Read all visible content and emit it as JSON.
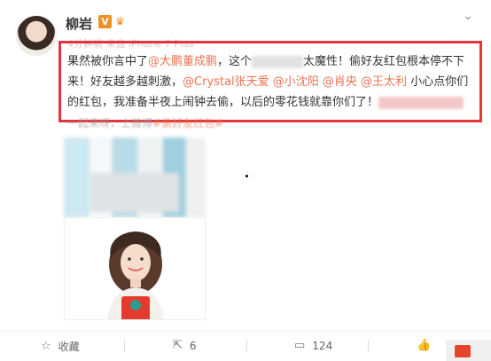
{
  "post": {
    "username": "柳岩",
    "badge_v": "V",
    "meta": "4分钟前 来自 iPhone 7 Plus",
    "text": {
      "p1": "果然被你言中了",
      "mention1": "@大鹏董成鹏",
      "p2": "，这个",
      "p3": "太魔性！偷好友红包根本停不下来！好友越多越刺激，",
      "mention2": "@Crystal张天爱",
      "mention3": "@小沈阳",
      "mention4": "@肖央",
      "mention5": "@王太利",
      "p4": " 小心点你们的红包，我准备半夜上闹钟去偷，以后的零花钱就靠你们了！"
    },
    "under_text": "一起来呀，上微博",
    "under_link": "#偷好友红包#"
  },
  "actions": {
    "collect_label": "收藏",
    "repost_count": "6",
    "comment_count": "124"
  },
  "colors": {
    "mention": "#eb7350",
    "highlight": "#e4343c",
    "vip": "#f29021"
  }
}
